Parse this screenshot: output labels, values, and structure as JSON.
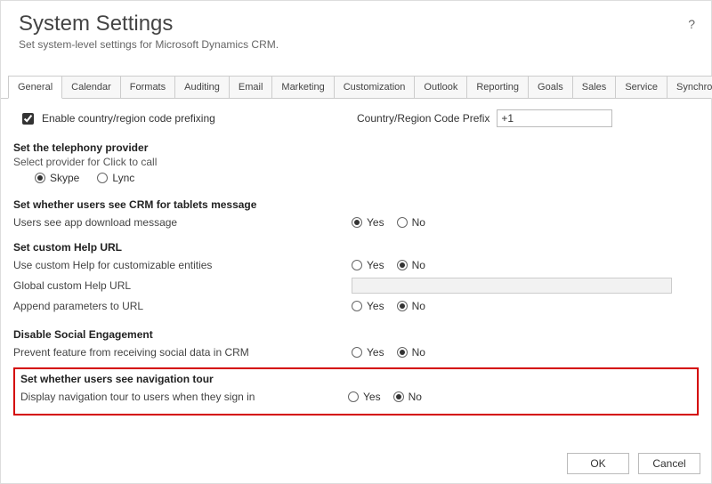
{
  "header": {
    "title": "System Settings",
    "subtitle": "Set system-level settings for Microsoft Dynamics CRM.",
    "help_glyph": "?"
  },
  "tabs": [
    "General",
    "Calendar",
    "Formats",
    "Auditing",
    "Email",
    "Marketing",
    "Customization",
    "Outlook",
    "Reporting",
    "Goals",
    "Sales",
    "Service",
    "Synchronization"
  ],
  "active_tab": "General",
  "prefix": {
    "checkbox_label": "Enable country/region code prefixing",
    "checked": true,
    "field_label": "Country/Region Code Prefix",
    "value": "+1"
  },
  "telephony": {
    "heading": "Set the telephony provider",
    "sub": "Select provider for Click to call",
    "options": {
      "skype": "Skype",
      "lync": "Lync"
    },
    "selected": "skype"
  },
  "tablets": {
    "heading": "Set whether users see CRM for tablets message",
    "row_label": "Users see app download message",
    "selected": "yes"
  },
  "help": {
    "heading": "Set custom Help URL",
    "row1_label": "Use custom Help for customizable entities",
    "row1_selected": "no",
    "row2_label": "Global custom Help URL",
    "row2_value": "",
    "row3_label": "Append parameters to URL",
    "row3_selected": "no"
  },
  "social": {
    "heading": "Disable Social Engagement",
    "row_label": "Prevent feature from receiving social data in CRM",
    "selected": "no"
  },
  "navtour": {
    "heading": "Set whether users see navigation tour",
    "row_label": "Display navigation tour to users when they sign in",
    "selected": "no"
  },
  "radio_labels": {
    "yes": "Yes",
    "no": "No"
  },
  "footer": {
    "ok": "OK",
    "cancel": "Cancel"
  }
}
